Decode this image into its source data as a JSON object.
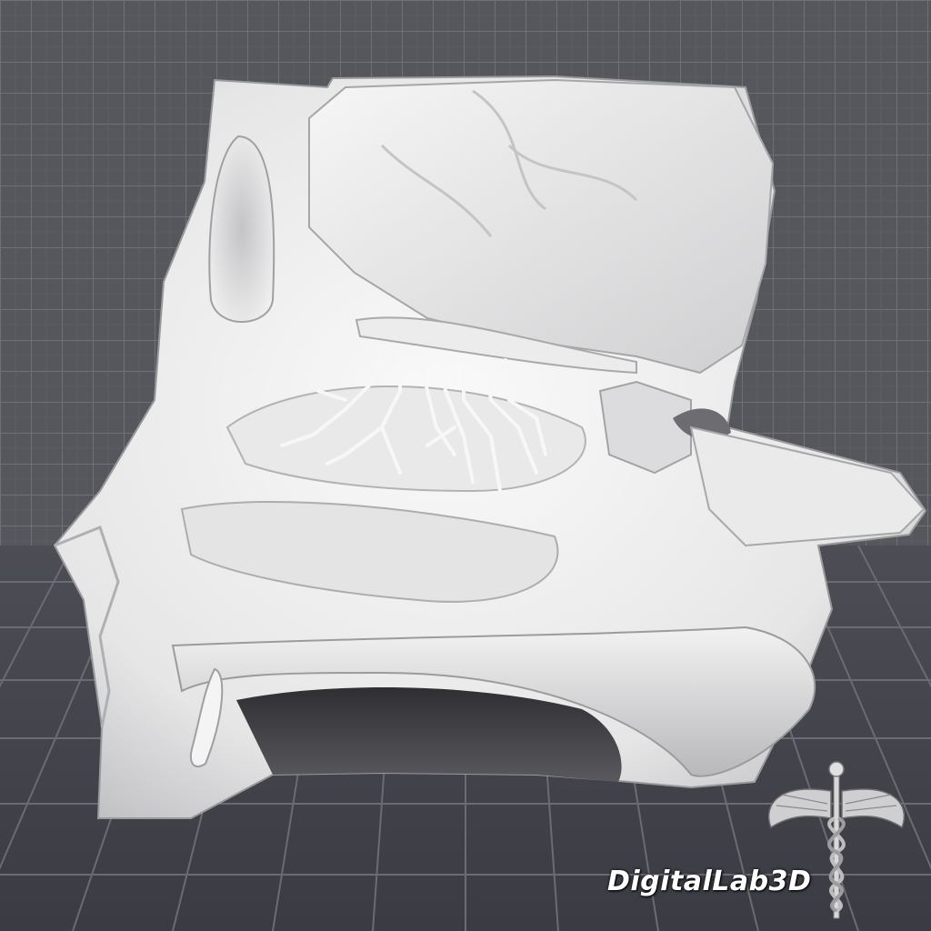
{
  "watermark": {
    "text": "DigitalLab3D"
  },
  "logo": {
    "icon": "caduceus-icon"
  },
  "colors": {
    "wall": "#56575d",
    "floor": "#3f4049",
    "grid_line": "#6f7077",
    "model_light": "#f1f1f1",
    "model_shadow": "#9c9c9e",
    "cavity_dark": "#444347"
  }
}
